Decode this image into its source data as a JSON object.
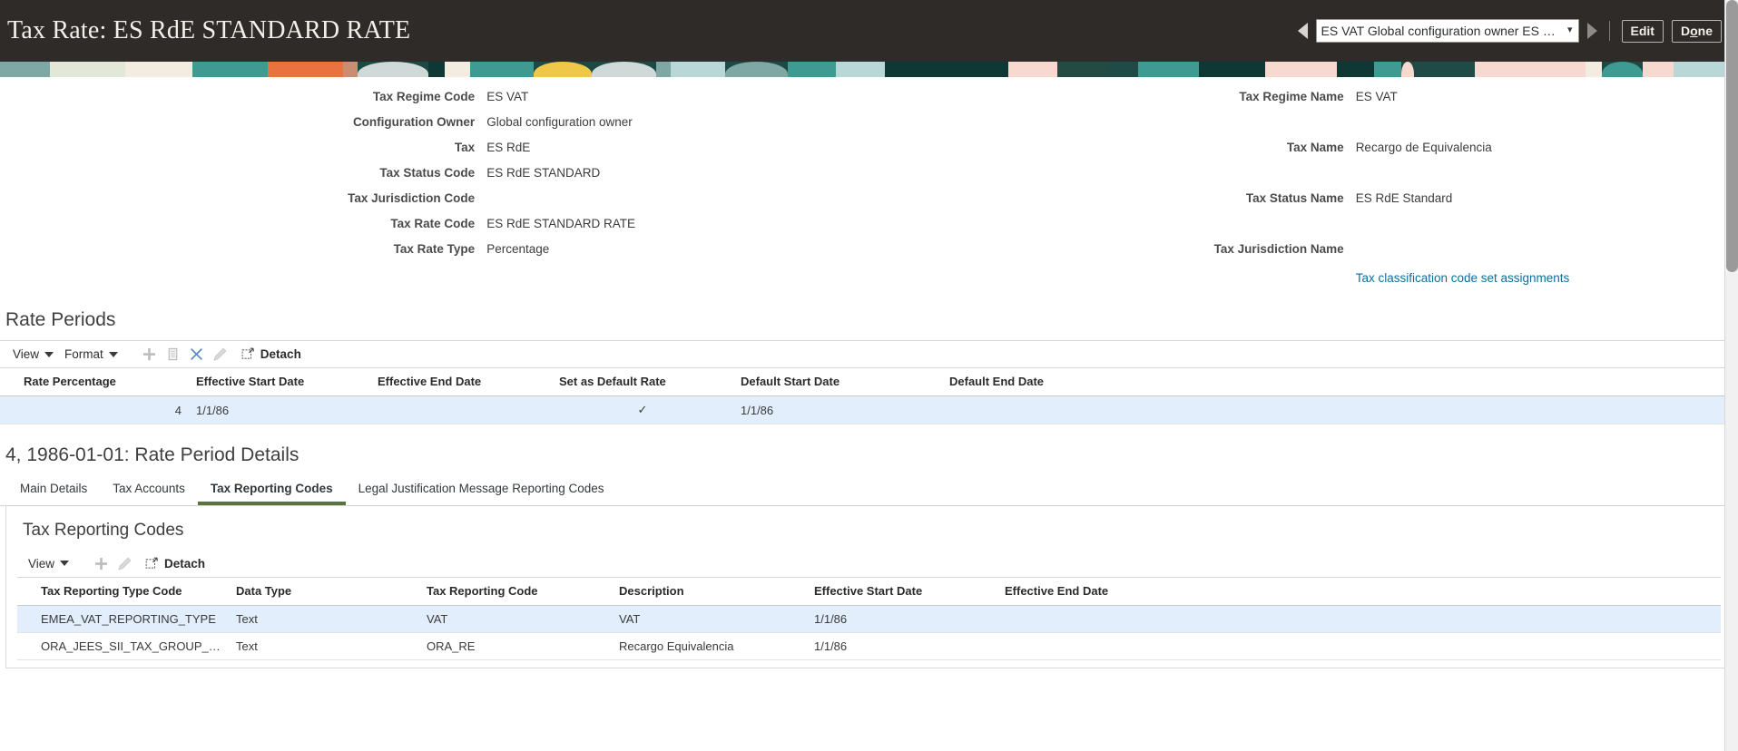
{
  "header": {
    "title": "Tax Rate: ES RdE STANDARD RATE",
    "record_selector_value": "ES VAT Global configuration owner ES RdE ES RdE",
    "prev_icon": "previous-record-arrow-icon",
    "next_icon": "next-record-arrow-icon",
    "chevron_icon": "chevron-down-icon",
    "edit_label": "Edit",
    "done_label_pre": "D",
    "done_label_key": "o",
    "done_label_post": "ne",
    "done_label": "Done",
    "bar_color": "#2e2b28"
  },
  "summary": {
    "left": [
      {
        "label": "Tax Regime Code",
        "value": "ES VAT"
      },
      {
        "label": "Configuration Owner",
        "value": "Global configuration owner"
      },
      {
        "label": "Tax",
        "value": "ES RdE"
      },
      {
        "label": "Tax Status Code",
        "value": "ES RdE STANDARD"
      },
      {
        "label": "Tax Jurisdiction Code",
        "value": ""
      },
      {
        "label": "Tax Rate Code",
        "value": "ES RdE STANDARD RATE"
      },
      {
        "label": "Tax Rate Type",
        "value": "Percentage"
      }
    ],
    "right": [
      {
        "label": "Tax Regime Name",
        "value": "ES VAT"
      },
      {
        "label": "",
        "value": ""
      },
      {
        "label": "Tax Name",
        "value": "Recargo de Equivalencia"
      },
      {
        "label": "",
        "value": ""
      },
      {
        "label": "Tax Status Name",
        "value": "ES RdE Standard"
      },
      {
        "label": "",
        "value": ""
      },
      {
        "label": "Tax Jurisdiction Name",
        "value": ""
      }
    ],
    "link_label": "Tax classification code set assignments",
    "link_color": "#0d6e9e"
  },
  "rate_periods": {
    "section_title": "Rate Periods",
    "toolbar": {
      "view_label": "View",
      "format_label": "Format",
      "detach_label": "Detach",
      "icons": [
        "add-icon",
        "duplicate-icon",
        "delete-icon",
        "edit-pencil-icon",
        "detach-icon"
      ]
    },
    "columns": [
      "Rate Percentage",
      "Effective Start Date",
      "Effective End Date",
      "Set as Default Rate",
      "Default Start Date",
      "Default End Date"
    ],
    "rows": [
      {
        "rate_percentage": "4",
        "effective_start_date": "1/1/86",
        "effective_end_date": "",
        "set_as_default_rate": "✓",
        "default_start_date": "1/1/86",
        "default_end_date": "",
        "selected": true
      }
    ]
  },
  "rate_period_details": {
    "title": "4, 1986-01-01: Rate Period Details",
    "tabs": [
      {
        "label": "Main Details",
        "active": false
      },
      {
        "label": "Tax Accounts",
        "active": false
      },
      {
        "label": "Tax Reporting Codes",
        "active": true
      },
      {
        "label": "Legal Justification Message Reporting Codes",
        "active": false
      }
    ],
    "active_tab_color": "#57753c"
  },
  "tax_reporting_codes": {
    "panel_title": "Tax Reporting Codes",
    "toolbar": {
      "view_label": "View",
      "detach_label": "Detach",
      "icons": [
        "add-icon",
        "edit-pencil-icon",
        "detach-icon"
      ]
    },
    "columns": [
      "Tax Reporting Type Code",
      "Data Type",
      "Tax Reporting Code",
      "Description",
      "Effective Start Date",
      "Effective End Date"
    ],
    "rows": [
      {
        "tax_reporting_type_code": "EMEA_VAT_REPORTING_TYPE",
        "data_type": "Text",
        "tax_reporting_code": "VAT",
        "description": "VAT",
        "effective_start_date": "1/1/86",
        "effective_end_date": "",
        "selected": true
      },
      {
        "tax_reporting_type_code": "ORA_JEES_SII_TAX_GROUP_TYPE",
        "data_type": "Text",
        "tax_reporting_code": "ORA_RE",
        "description": "Recargo Equivalencia",
        "effective_start_date": "1/1/86",
        "effective_end_date": "",
        "selected": false
      }
    ]
  }
}
